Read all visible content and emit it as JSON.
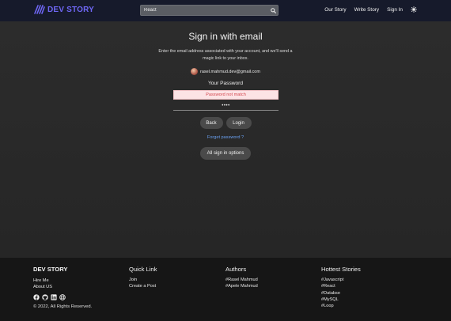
{
  "navbar": {
    "brand": "DEV STORY",
    "search_value": "React",
    "links": [
      "Our Story",
      "Write Story",
      "Sign In"
    ]
  },
  "signin": {
    "title": "Sign in with email",
    "description": "Enter the email address associated with your account, and we'll send a magic link to your inbox.",
    "email": "rasel.mahmud.dev@gmail.com",
    "password_label": "Your Password",
    "error": "Password not match",
    "password_value": "••••",
    "back_label": "Back",
    "login_label": "Login",
    "forgot_label": "Forget password ?",
    "all_options_label": "All sign in options"
  },
  "footer": {
    "brand": "DEV STORY",
    "brand_links": [
      "Hire Me",
      "About US"
    ],
    "copyright": "© 2022, All Rights Reserved.",
    "quick_link": {
      "heading": "Quick Link",
      "items": [
        "Join",
        "Create a Post"
      ]
    },
    "authors": {
      "heading": "Authors",
      "items": [
        "#Rasel Mahmud",
        "#Apele Mahmud"
      ]
    },
    "hottest": {
      "heading": "Hottest Stories",
      "items": [
        "#Javascript",
        "#React",
        "#Databse",
        "#MySQL",
        "#Loop"
      ]
    },
    "social_icons": [
      "facebook-icon",
      "github-icon",
      "linkedin-icon",
      "globe-icon"
    ]
  },
  "colors": {
    "brand": "#6f67f5",
    "navbar_bg": "#161a2b",
    "error_bg": "#fce3e5",
    "error_text": "#d4474f",
    "link": "#6aa0f0"
  }
}
